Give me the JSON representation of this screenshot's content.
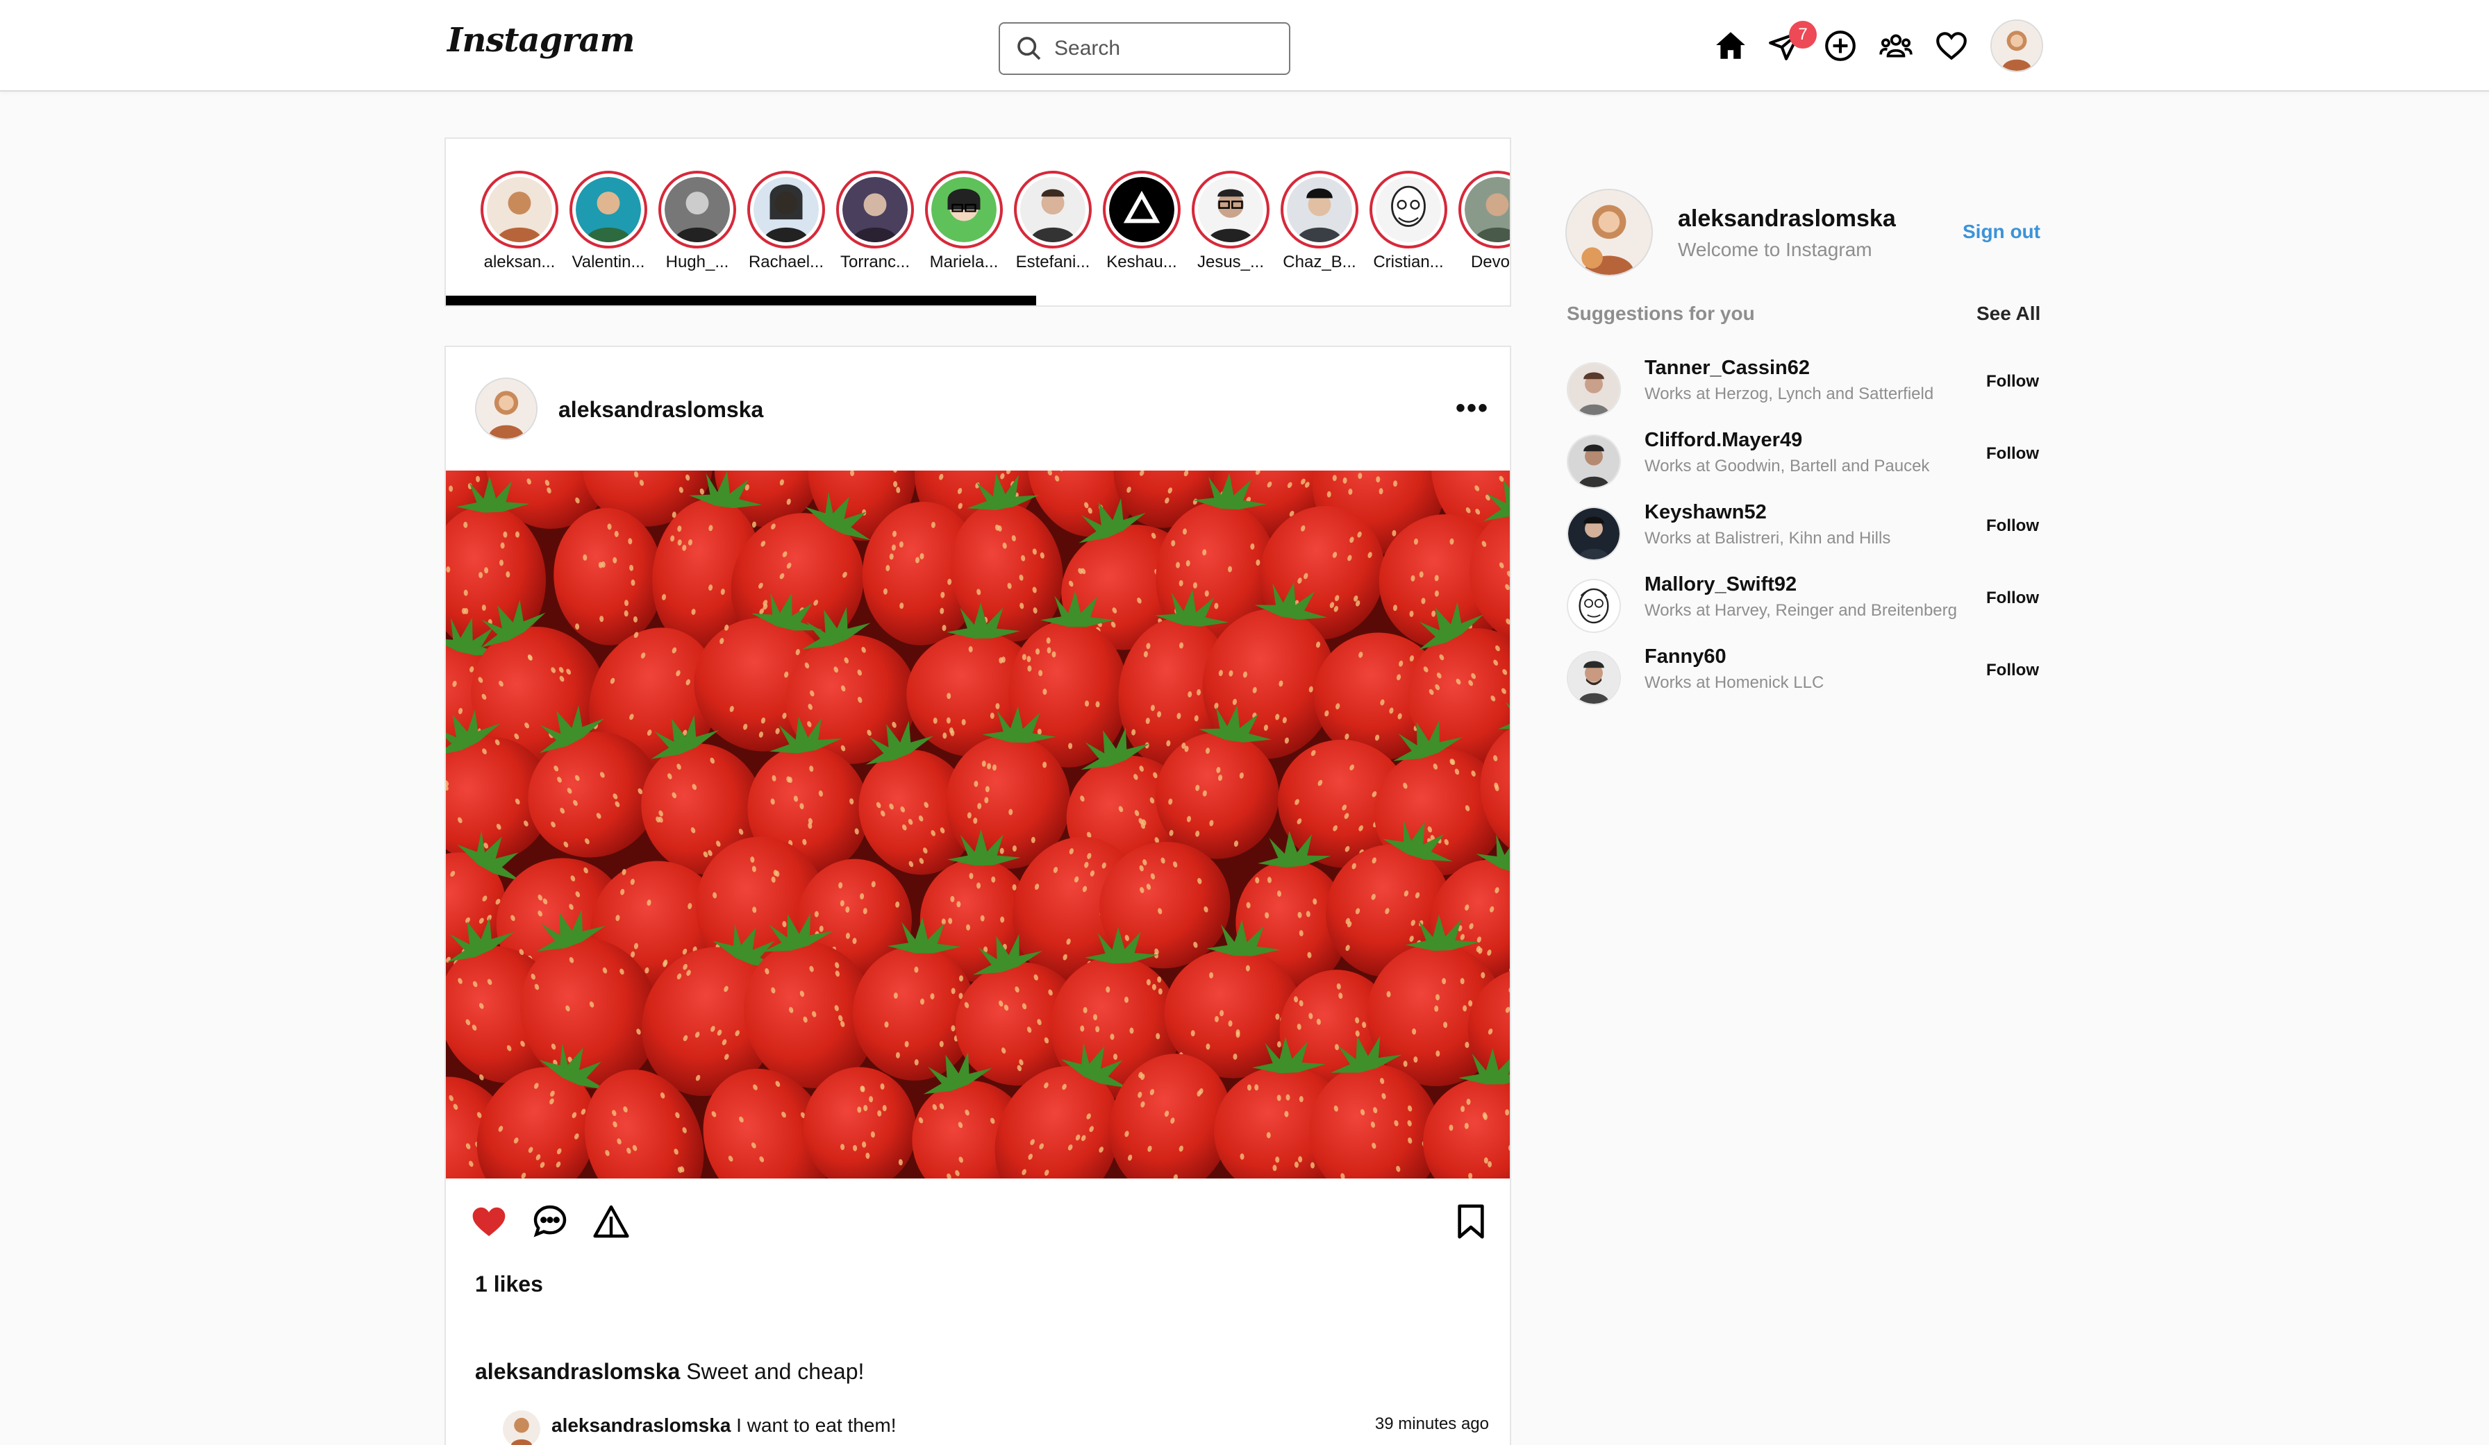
{
  "nav": {
    "logo": "Instagram",
    "search_placeholder": "Search",
    "messages_badge": "7",
    "icons": [
      "home-icon",
      "direct-message-icon",
      "new-post-icon",
      "explore-people-icon",
      "activity-heart-icon"
    ]
  },
  "stories": {
    "items": [
      {
        "name": "aleksan...",
        "color": "#d9a27a"
      },
      {
        "name": "Valentin...",
        "color": "#1e9bb0"
      },
      {
        "name": "Hugh_...",
        "color": "#555555"
      },
      {
        "name": "Rachael...",
        "color": "#2b2b2b"
      },
      {
        "name": "Torranc...",
        "color": "#6b5b7b"
      },
      {
        "name": "Mariela...",
        "color": "#5fc15a"
      },
      {
        "name": "Estefani...",
        "color": "#8a7a6a"
      },
      {
        "name": "Keshau...",
        "color": "#000000"
      },
      {
        "name": "Jesus_...",
        "color": "#cfcfcf"
      },
      {
        "name": "Chaz_B...",
        "color": "#3a3f46"
      },
      {
        "name": "Cristian...",
        "color": "#e0e0e0"
      },
      {
        "name": "Devont",
        "color": "#6a7a6a"
      }
    ]
  },
  "post": {
    "username": "aleksandraslomska",
    "more_label": "•••",
    "likes": "1 likes",
    "caption_user": "aleksandraslomska",
    "caption_text": " Sweet and cheap!",
    "comment_user": "aleksandraslomska",
    "comment_text": " I want to eat them!",
    "comment_time": "39 minutes ago",
    "liked": true,
    "like_color": "#d92b2b"
  },
  "sidebar": {
    "username": "aleksandraslomska",
    "welcome": "Welcome to Instagram",
    "signout": "Sign out",
    "suggestions_title": "Suggestions for you",
    "see_all": "See All",
    "suggestions": [
      {
        "name": "Tanner_Cassin62",
        "sub": "Works at Herzog, Lynch and Satterfield",
        "follow": "Follow"
      },
      {
        "name": "Clifford.Mayer49",
        "sub": "Works at Goodwin, Bartell and Paucek",
        "follow": "Follow"
      },
      {
        "name": "Keyshawn52",
        "sub": "Works at Balistreri, Kihn and Hills",
        "follow": "Follow"
      },
      {
        "name": "Mallory_Swift92",
        "sub": "Works at Harvey, Reinger and Breitenberg",
        "follow": "Follow"
      },
      {
        "name": "Fanny60",
        "sub": "Works at Homenick LLC",
        "follow": "Follow"
      }
    ]
  },
  "colors": {
    "accent_blue": "#3b93d8",
    "story_ring": "#d6293a",
    "badge": "#ed4956"
  }
}
